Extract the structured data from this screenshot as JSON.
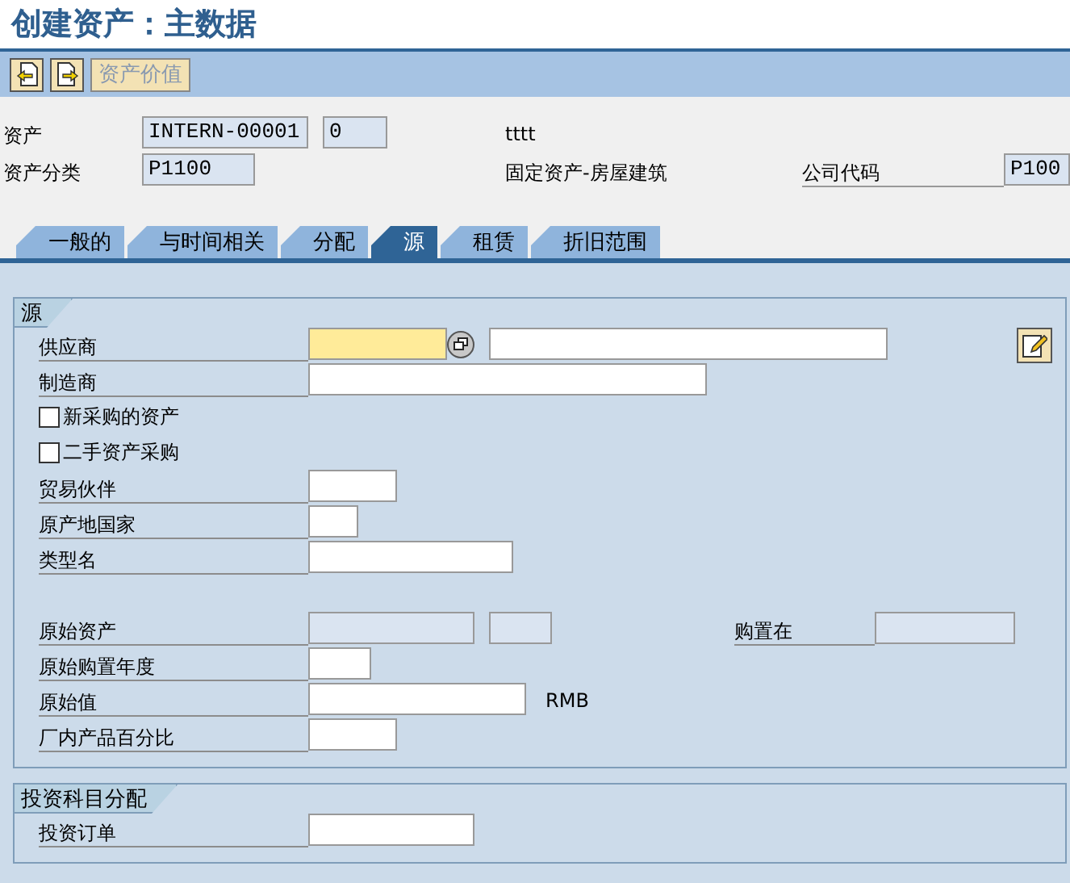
{
  "window": {
    "title": "创建资产：主数据"
  },
  "toolbar": [
    {
      "kind": "prev",
      "disabled": false
    },
    {
      "kind": "next",
      "disabled": false
    },
    {
      "kind": "text",
      "label": "资产价值",
      "disabled": true
    }
  ],
  "header": [
    {
      "label": "资产",
      "fields": [
        {
          "value": "INTERN-00001",
          "disabled": true
        },
        {
          "value": "0",
          "disabled": true
        }
      ],
      "note": "tttt"
    },
    {
      "label": "资产分类",
      "fields": [
        {
          "value": "P1100",
          "disabled": true
        }
      ],
      "note": "固定资产-房屋建筑",
      "extra": {
        "label": "公司代码",
        "fields": [
          {
            "value": "P100",
            "disabled": true
          }
        ]
      }
    }
  ],
  "tabs": [
    {
      "label": "一般的",
      "selected": false
    },
    {
      "label": "与时间相关",
      "selected": false
    },
    {
      "label": "分配",
      "selected": false
    },
    {
      "label": "源",
      "selected": true
    },
    {
      "label": "租赁",
      "selected": false
    },
    {
      "label": "折旧范围",
      "selected": false
    }
  ],
  "groups": [
    {
      "title": "源",
      "blocks": [
        [
          {
            "kind": "field",
            "label": "供应商",
            "fields": [
              {
                "required": true,
                "disabled": false,
                "search_help": true
              },
              {
                "required": false,
                "disabled": false
              }
            ],
            "edit_button": true
          },
          {
            "kind": "field",
            "label": "制造商",
            "fields": [
              {
                "required": false,
                "disabled": false
              }
            ]
          },
          {
            "kind": "checkbox",
            "label": "新采购的资产",
            "checked": false
          },
          {
            "kind": "checkbox",
            "label": "二手资产采购",
            "checked": false
          },
          {
            "kind": "field",
            "label": "贸易伙伴",
            "fields": [
              {
                "required": false,
                "disabled": false
              }
            ]
          },
          {
            "kind": "field",
            "label": "原产地国家",
            "fields": [
              {
                "required": false,
                "disabled": false
              }
            ]
          },
          {
            "kind": "field",
            "label": "类型名",
            "fields": [
              {
                "required": false,
                "disabled": false
              }
            ]
          }
        ],
        [
          {
            "kind": "field",
            "label": "原始资产",
            "fields": [
              {
                "disabled": true
              },
              {
                "disabled": true
              }
            ],
            "extra": {
              "label": "购置在",
              "fields": [
                {
                  "disabled": true
                }
              ]
            }
          },
          {
            "kind": "field",
            "label": "原始购置年度",
            "fields": [
              {
                "required": false,
                "disabled": false
              }
            ]
          },
          {
            "kind": "field",
            "label": "原始值",
            "fields": [
              {
                "required": false,
                "disabled": false
              }
            ],
            "unit": "RMB"
          },
          {
            "kind": "field",
            "label": "厂内产品百分比",
            "fields": [
              {
                "required": false,
                "disabled": false
              }
            ]
          }
        ]
      ]
    },
    {
      "title": "投资科目分配",
      "blocks": [
        [
          {
            "kind": "field",
            "label": "投资订单",
            "fields": [
              {
                "required": false,
                "disabled": false
              }
            ]
          }
        ]
      ]
    }
  ]
}
